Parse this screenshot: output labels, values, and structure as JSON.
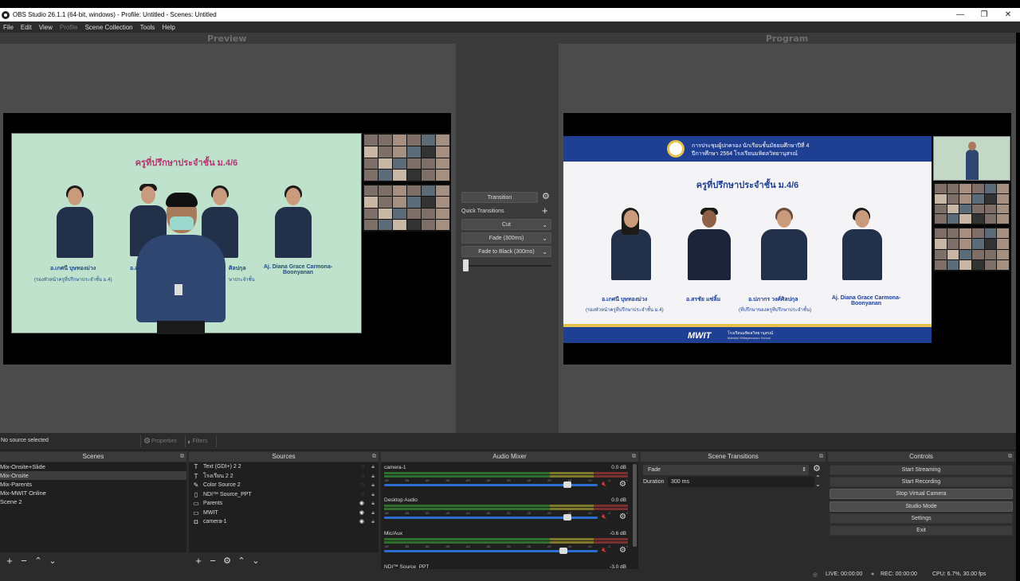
{
  "window": {
    "title": "OBS Studio 26.1.1 (64-bit, windows) - Profile: Untitled - Scenes: Untitled",
    "minimize": "—",
    "maximize": "❐",
    "close": "✕"
  },
  "menu": [
    "File",
    "Edit",
    "View",
    "Profile",
    "Scene Collection",
    "Tools",
    "Help"
  ],
  "preview": {
    "label": "Preview",
    "slide_title": "ครูที่ปรึกษาประจำชั้น ม.4/6",
    "captions": [
      {
        "name": "อ.เกศนี บุษทองม่วง",
        "role": "(รองหัวหน้าครูที่ปรึกษาประจำชั้น ม.4)"
      },
      {
        "name": "อ.ส",
        "role": ""
      },
      {
        "name": "ศิลปกุล",
        "role": "ษาประจำชั้น"
      },
      {
        "name": "Aj. Diana Grace Carmona-Boonyanan",
        "role": ""
      }
    ]
  },
  "program": {
    "label": "Program",
    "header_line1": "การประชุมผู้ปกครอง นักเรียนชั้นมัธยมศึกษาปีที่ 4",
    "header_line2": "ปีการศึกษา 2564 โรงเรียนมหิดลวิทยานุสรณ์",
    "slide_title": "ครูที่ปรึกษาประจำชั้น ม.4/6",
    "captions": [
      {
        "name": "อ.เกศนี บุษทองม่วง",
        "role": "(รองหัวหน้าครูที่ปรึกษาประจำชั้น ม.4)"
      },
      {
        "name": "อ.สรชัย แซ่ลิ้ม",
        "role": ""
      },
      {
        "name": "อ.ปภากร วงศ์ศิลปกุล",
        "role": "(ที่ปรึกษาของครูที่ปรึกษาประจำชั้น)"
      },
      {
        "name": "Aj. Diana Grace Carmona-Boonyanan",
        "role": ""
      }
    ],
    "footer_logo": "MWIT",
    "footer_text": "โรงเรียนมหิดลวิทยานุสรณ์",
    "footer_sub": "Mahidol Wittayanusorn School"
  },
  "transitions_panel": {
    "transition_label": "Transition",
    "quick_label": "Quick Transitions",
    "cut": "Cut",
    "fade": "Fade (300ms)",
    "fade_black": "Fade to Black (300ms)"
  },
  "source_toolbar": {
    "no_source": "No source selected",
    "properties": "Properties",
    "filters": "Filters"
  },
  "scenes": {
    "title": "Scenes",
    "items": [
      "Mix-Onsite+Slide",
      "Mix-Onsite",
      "Mix-Parents",
      "Mix-MWIT Online",
      "Scene 2"
    ],
    "selected": "Mix-Onsite"
  },
  "sources": {
    "title": "Sources",
    "items": [
      {
        "name": "Text (GDI+) 2 2",
        "icon": "text-icon",
        "visible": false
      },
      {
        "name": "โรงเรียน 2 2",
        "icon": "text-icon",
        "visible": false
      },
      {
        "name": "Color Source 2",
        "icon": "brush-icon",
        "visible": false
      },
      {
        "name": "NDI™ Source_PPT",
        "icon": "file-icon",
        "visible": false
      },
      {
        "name": "Parents",
        "icon": "window-icon",
        "visible": true
      },
      {
        "name": "MWIT",
        "icon": "window-icon",
        "visible": true
      },
      {
        "name": "camera-1",
        "icon": "camera-icon",
        "visible": true
      }
    ]
  },
  "audio_mixer": {
    "title": "Audio Mixer",
    "ticks": [
      "-60",
      "-55",
      "-50",
      "-45",
      "-40",
      "-35",
      "-30",
      "-25",
      "-20",
      "-15",
      "-10",
      "-5",
      "0"
    ],
    "channels": [
      {
        "name": "camera-1",
        "db": "0.0 dB",
        "level": 0.86
      },
      {
        "name": "Desktop Audio",
        "db": "0.0 dB",
        "level": 0.86
      },
      {
        "name": "Mic/Aux",
        "db": "-0.6 dB",
        "level": 0.84
      },
      {
        "name": "NDI™ Source_PPT",
        "db": "-3.0 dB",
        "level": 0.8
      }
    ]
  },
  "scene_transitions": {
    "title": "Scene Transitions",
    "selected": "Fade",
    "duration_label": "Duration",
    "duration_value": "300 ms"
  },
  "controls": {
    "title": "Controls",
    "buttons": [
      "Start Streaming",
      "Start Recording",
      "Stop Virtual Camera",
      "Studio Mode",
      "Settings",
      "Exit"
    ]
  },
  "status": {
    "live": "LIVE: 00:00:00",
    "rec": "REC: 00:00:00",
    "cpu": "CPU: 6.7%, 30.00 fps"
  },
  "colors": {
    "accent": "#2d6fd1",
    "mute": "#e33333",
    "slide_blue": "#1f3f92",
    "slide_pink": "#b43572"
  }
}
